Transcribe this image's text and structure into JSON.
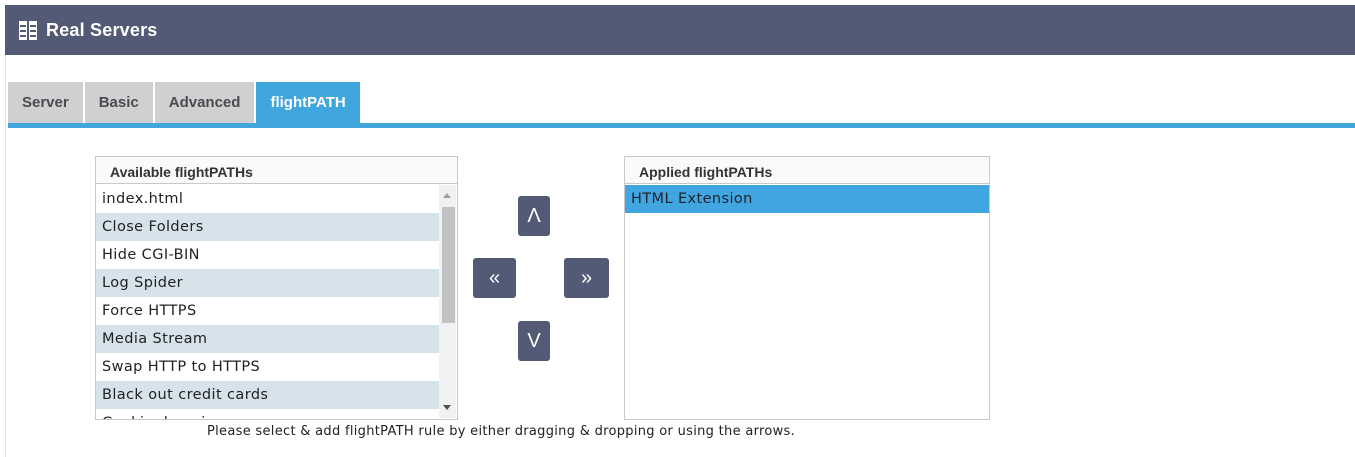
{
  "header": {
    "title": "Real Servers",
    "icon": "servers-icon"
  },
  "tabs": [
    {
      "label": "Server",
      "active": false
    },
    {
      "label": "Basic",
      "active": false
    },
    {
      "label": "Advanced",
      "active": false
    },
    {
      "label": "flightPATH",
      "active": true
    }
  ],
  "available": {
    "heading": "Available flightPATHs",
    "items": [
      "index.html",
      "Close Folders",
      "Hide CGI-BIN",
      "Log Spider",
      "Force HTTPS",
      "Media Stream",
      "Swap HTTP to HTTPS",
      "Black out credit cards",
      "Cookie domain"
    ]
  },
  "applied": {
    "heading": "Applied flightPATHs",
    "items": [
      "HTML Extension"
    ],
    "selected_index": 0
  },
  "arrows": {
    "up": "Λ",
    "left": "«",
    "right": "»",
    "down": "V"
  },
  "hint": "Please select & add flightPATH rule by either dragging & dropping or using the arrows.",
  "colors": {
    "header": "#525a75",
    "accent": "#3fa7dd",
    "row_alt": "#d6e3ea",
    "selected": "#41a5e0"
  }
}
